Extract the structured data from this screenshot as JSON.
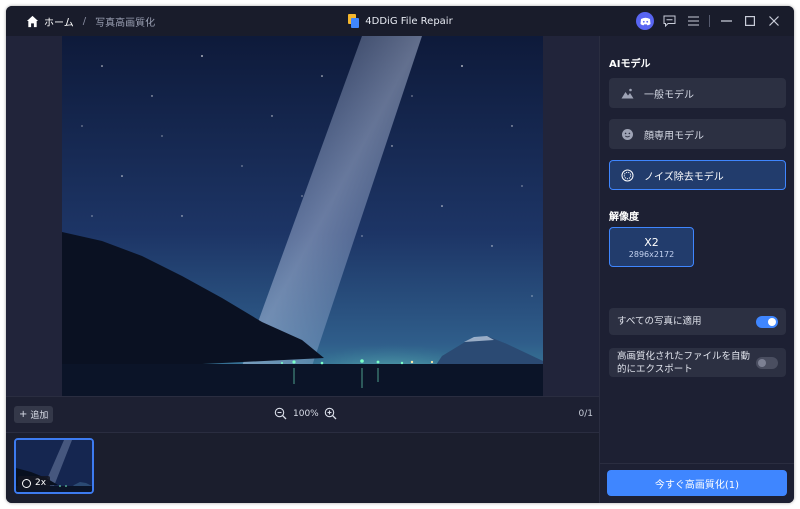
{
  "titlebar": {
    "home_label": "ホーム",
    "separator": "/",
    "current_page": "写真高画質化",
    "app_title": "4DDiG File Repair"
  },
  "preview": {
    "add_label": "追加",
    "zoom_level": "100%",
    "page_count": "0/1"
  },
  "filmstrip": {
    "thumb_badge": "2x"
  },
  "panel": {
    "ai_model_title": "AIモデル",
    "models": [
      {
        "label": "一般モデル",
        "icon": "mountain-icon",
        "active": false
      },
      {
        "label": "顔専用モデル",
        "icon": "face-icon",
        "active": false
      },
      {
        "label": "ノイズ除去モデル",
        "icon": "noise-icon",
        "active": true
      }
    ],
    "resolution_title": "解像度",
    "resolution": {
      "scale": "X2",
      "size": "2896x2172"
    },
    "apply_all_label": "すべての写真に適用",
    "apply_all_on": true,
    "auto_export_label": "高画質化されたファイルを自動的にエクスポート",
    "auto_export_on": false,
    "enhance_button": "今すぐ高画質化(1)"
  },
  "colors": {
    "accent": "#3f86ff",
    "window_bg": "#1b1e2d",
    "panel_bg": "#1d2033",
    "card_bg": "#2c3042"
  }
}
